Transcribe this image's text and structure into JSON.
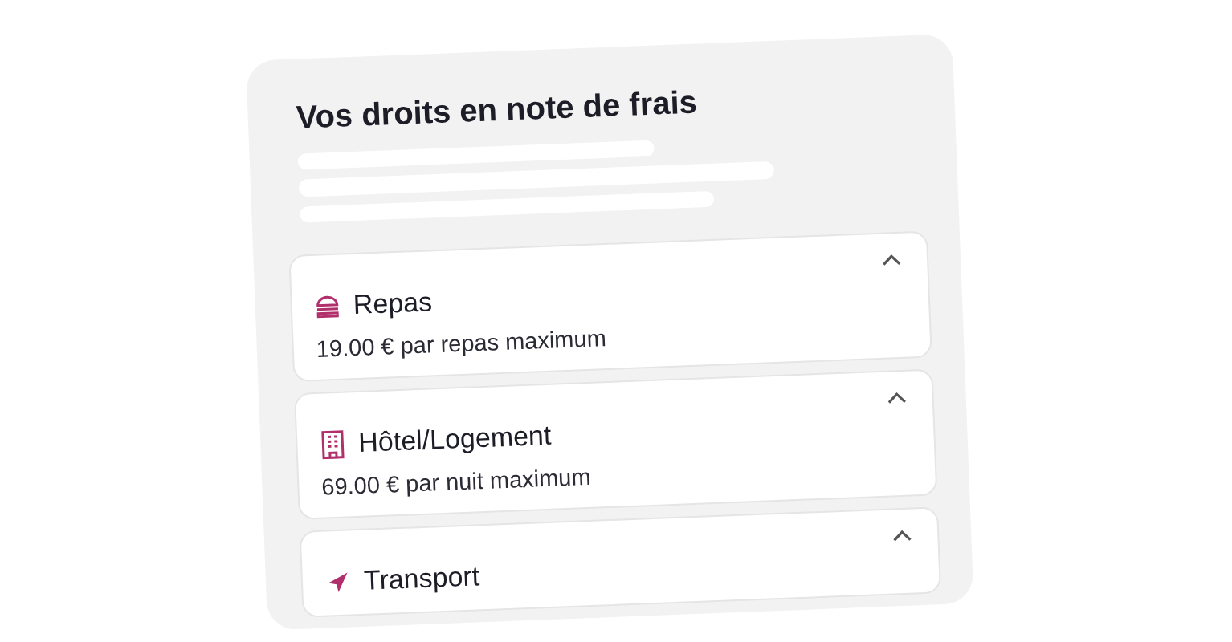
{
  "card": {
    "title": "Vos droits en note de frais"
  },
  "items": [
    {
      "kind": "meal",
      "label": "Repas",
      "detail": "19.00 € par repas maximum",
      "expanded": true
    },
    {
      "kind": "hotel",
      "label": "Hôtel/Logement",
      "detail": "69.00 € par nuit maximum",
      "expanded": true
    },
    {
      "kind": "transport",
      "label": "Transport",
      "expanded": true
    }
  ]
}
